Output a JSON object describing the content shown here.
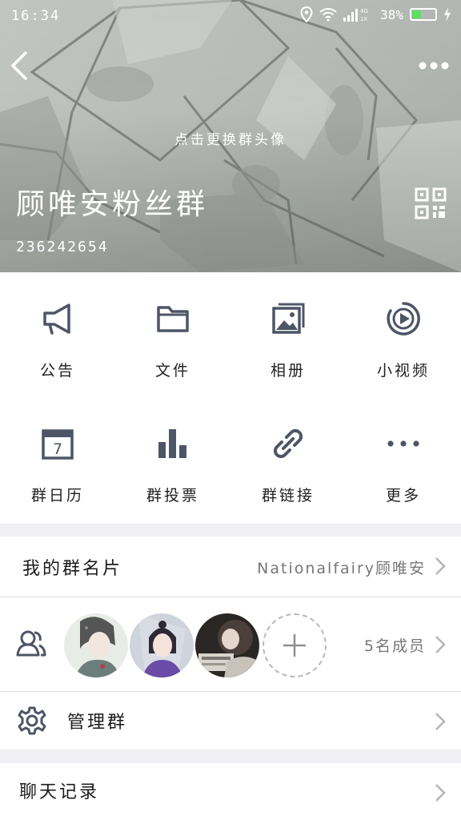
{
  "status_bar": {
    "time": "16:34",
    "network_top": "4G",
    "network_bottom": "1X",
    "battery_percent": "38%",
    "battery_level": 0.38,
    "battery_color": "#5de05d"
  },
  "header": {
    "change_avatar_hint": "点击更换群头像",
    "group_name": "顾唯安粉丝群",
    "group_id": "236242654"
  },
  "features": [
    {
      "label": "公告",
      "icon": "megaphone-icon"
    },
    {
      "label": "文件",
      "icon": "folder-icon"
    },
    {
      "label": "相册",
      "icon": "photo-album-icon"
    },
    {
      "label": "小视频",
      "icon": "video-play-icon"
    },
    {
      "label": "群日历",
      "icon": "calendar-icon"
    },
    {
      "label": "群投票",
      "icon": "bar-chart-icon"
    },
    {
      "label": "群链接",
      "icon": "link-icon"
    },
    {
      "label": "更多",
      "icon": "more-dots-icon"
    }
  ],
  "calendar_day": "7",
  "my_card": {
    "title": "我的群名片",
    "value": "Nationalfairy顾唯安"
  },
  "members": {
    "count_text": "5名成员"
  },
  "manage": {
    "title": "管理群"
  },
  "chat_history": {
    "title": "聊天记录"
  },
  "colors": {
    "icon": "#4d5566",
    "accent_green": "#5de05d"
  }
}
